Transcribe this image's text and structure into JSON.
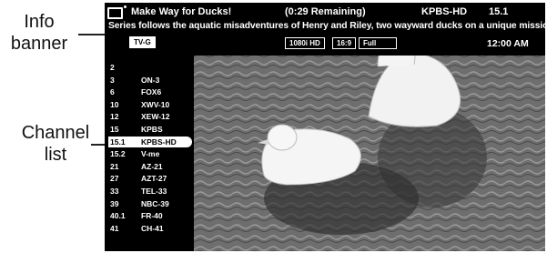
{
  "callouts": {
    "info_banner": [
      "Info",
      "banner"
    ],
    "channel_list": [
      "Channel",
      "list"
    ]
  },
  "banner": {
    "icon": "tv-icon",
    "program_title": "Make Way for Ducks!",
    "remaining": "(0:29 Remaining)",
    "station": "KPBS-HD",
    "channel": "15.1",
    "description": "Series follows the aquatic misadventures of Henry and Riley, two wayward ducks on a unique mission.",
    "rating": "TV-G",
    "resolution": "1080i HD",
    "aspect": "16:9",
    "picture_mode": "Full",
    "clock": "12:00 AM"
  },
  "channel_list": {
    "selected_index": 7,
    "items": [
      {
        "num": "2",
        "name": ""
      },
      {
        "num": "3",
        "name": "ON-3"
      },
      {
        "num": "6",
        "name": "FOX6"
      },
      {
        "num": "10",
        "name": "XWV-10"
      },
      {
        "num": "12",
        "name": "XEW-12"
      },
      {
        "num": "15",
        "name": "KPBS"
      },
      {
        "num": "15.1",
        "name": "KPBS-HD"
      },
      {
        "num": "15.2",
        "name": "V-me"
      },
      {
        "num": "21",
        "name": "AZ-21"
      },
      {
        "num": "27",
        "name": "AZT-27"
      },
      {
        "num": "33",
        "name": "TEL-33"
      },
      {
        "num": "39",
        "name": "NBC-39"
      },
      {
        "num": "40.1",
        "name": "FR-40"
      },
      {
        "num": "41",
        "name": "CH-41"
      }
    ]
  }
}
